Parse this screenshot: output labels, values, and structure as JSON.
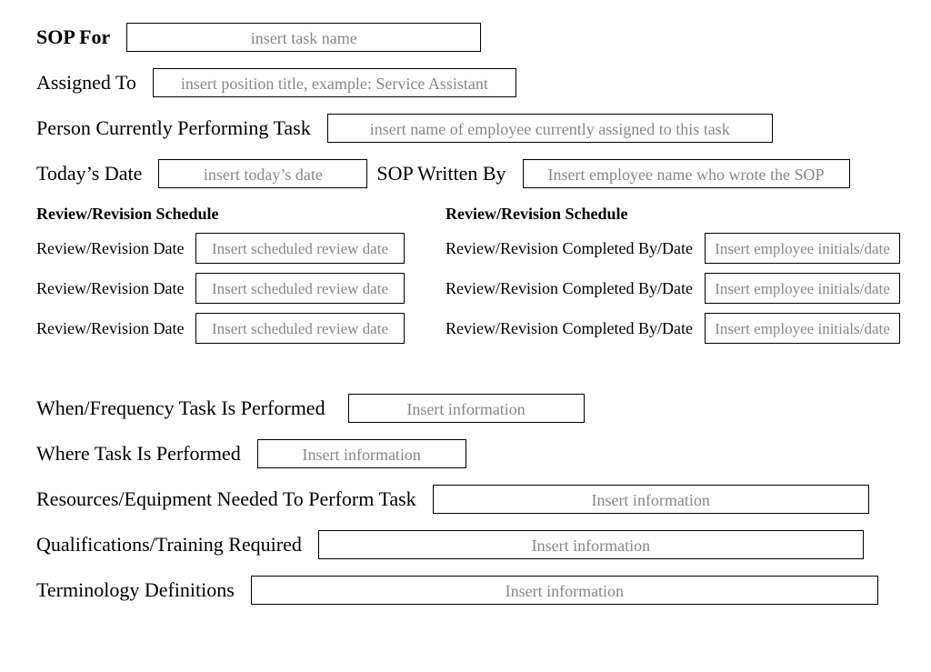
{
  "sop_for": {
    "label": "SOP For",
    "placeholder": "insert task name"
  },
  "assigned_to": {
    "label": "Assigned To",
    "placeholder": "insert position title, example: Service Assistant"
  },
  "person_performing": {
    "label": "Person Currently Performing Task",
    "placeholder": "insert name of employee currently assigned to this task"
  },
  "todays_date": {
    "label": "Today’s Date",
    "placeholder": "insert today’s date"
  },
  "written_by": {
    "label": "SOP Written By",
    "placeholder": "Insert employee name who wrote the SOP"
  },
  "left_schedule": {
    "header": "Review/Revision Schedule",
    "rows": [
      {
        "label": "Review/Revision Date",
        "placeholder": "Insert scheduled review date"
      },
      {
        "label": "Review/Revision Date",
        "placeholder": "Insert scheduled review date"
      },
      {
        "label": "Review/Revision Date",
        "placeholder": "Insert scheduled review date"
      }
    ]
  },
  "right_schedule": {
    "header": "Review/Revision Schedule",
    "rows": [
      {
        "label": "Review/Revision Completed By/Date",
        "placeholder": "Insert employee initials/date"
      },
      {
        "label": "Review/Revision Completed By/Date",
        "placeholder": "Insert employee initials/date"
      },
      {
        "label": "Review/Revision Completed By/Date",
        "placeholder": "Insert employee initials/date"
      }
    ]
  },
  "when_frequency": {
    "label": "When/Frequency Task Is Performed",
    "placeholder": "Insert information"
  },
  "where": {
    "label": "Where Task Is Performed",
    "placeholder": "Insert information"
  },
  "resources": {
    "label": "Resources/Equipment Needed To Perform Task",
    "placeholder": "Insert information"
  },
  "qualifications": {
    "label": "Qualifications/Training Required",
    "placeholder": "Insert information"
  },
  "terminology": {
    "label": "Terminology Definitions",
    "placeholder": "Insert information"
  }
}
